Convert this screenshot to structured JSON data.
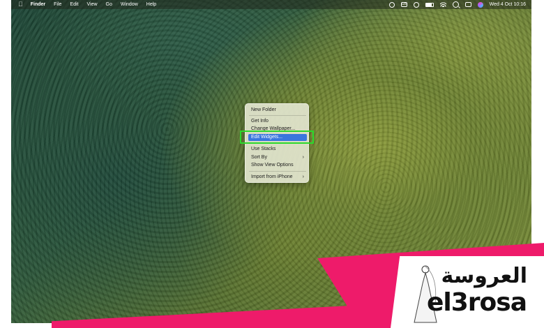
{
  "menubar": {
    "apple_icon": "apple-logo-icon",
    "items": [
      "Finder",
      "File",
      "Edit",
      "View",
      "Go",
      "Window",
      "Help"
    ],
    "status_icons": [
      "cloud-sync-icon",
      "display-badge-icon",
      "user-circle-icon",
      "battery-icon",
      "wifi-icon",
      "search-icon",
      "control-center-icon",
      "siri-icon"
    ],
    "status_badge": "GB",
    "datetime": "Wed 4 Oct  10:16"
  },
  "context_menu": {
    "items": [
      {
        "label": "New Folder",
        "submenu": false
      },
      {
        "label": "Get Info",
        "submenu": false
      },
      {
        "label": "Change Wallpaper...",
        "submenu": false
      },
      {
        "label": "Edit Widgets...",
        "submenu": false,
        "highlighted": true
      },
      {
        "label": "Use Stacks",
        "submenu": false
      },
      {
        "label": "Sort By",
        "submenu": true
      },
      {
        "label": "Show View Options",
        "submenu": false
      },
      {
        "label": "Import from iPhone",
        "submenu": true
      }
    ]
  },
  "annotation": {
    "color": "#2bd92b",
    "target": "Edit Widgets..."
  },
  "watermark": {
    "text_arabic": "العروسة",
    "text_latin": "el3rosa",
    "band_color": "#ee1b6a"
  }
}
